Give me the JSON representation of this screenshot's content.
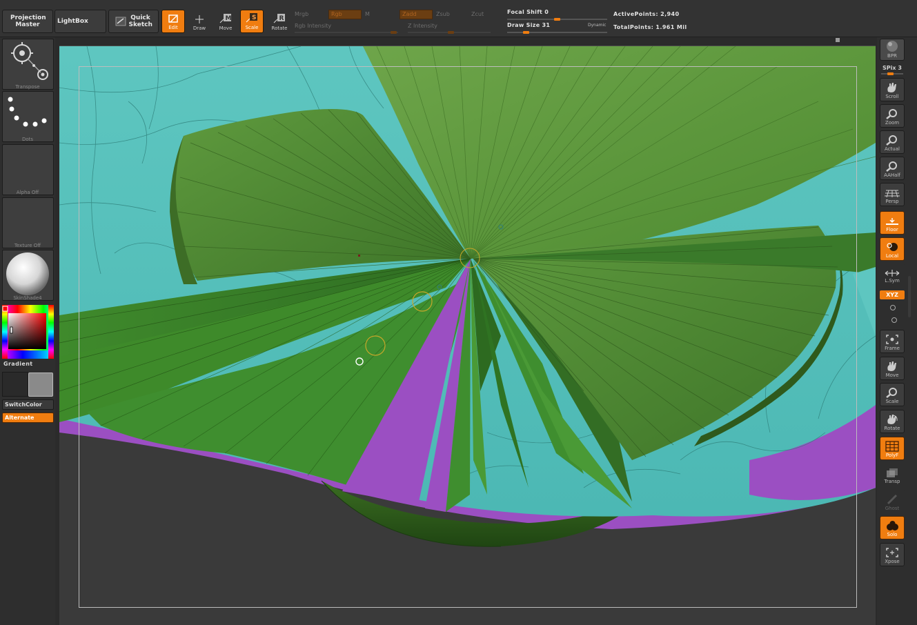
{
  "toolbar": {
    "projection_master": "Projection Master",
    "lightbox": "LightBox",
    "quick_sketch": "Quick Sketch",
    "tools": [
      {
        "label": "Edit",
        "active": true
      },
      {
        "label": "Draw",
        "active": false
      },
      {
        "label": "Move",
        "active": false
      },
      {
        "label": "Scale",
        "active": true
      },
      {
        "label": "Rotate",
        "active": false
      }
    ],
    "mrgb": "Mrgb",
    "rgb": "Rgb",
    "m": "M",
    "zadd": "Zadd",
    "zsub": "Zsub",
    "zcut": "Zcut",
    "rgb_intensity": "Rgb Intensity",
    "z_intensity": "Z Intensity",
    "focal_shift": "Focal Shift 0",
    "focal_shift_value": 0,
    "draw_size": "Draw Size 31",
    "draw_size_value": 31,
    "dynamic": "Dynamic",
    "active_points": "ActivePoints: 2,940",
    "total_points": "TotalPoints: 1.961 Mil"
  },
  "left_shelf": {
    "transpose": "Transpose",
    "dots": "Dots",
    "alpha": "Alpha Off",
    "texture": "Texture Off",
    "material": "SkinShade4",
    "gradient": "Gradient",
    "switch_color": "SwitchColor",
    "alternate": "Alternate",
    "colors": {
      "main": "#ff0000",
      "secondary": "#8a8a8a",
      "accent": "#f07d10"
    }
  },
  "right_shelf": {
    "bpr": "BPR",
    "spix": "SPix 3",
    "buttons": [
      {
        "label": "Scroll",
        "icon": "scroll-hand-icon",
        "active": false
      },
      {
        "label": "Zoom",
        "icon": "zoom-icon",
        "active": false
      },
      {
        "label": "Actual",
        "icon": "actual-zoom-icon",
        "active": false
      },
      {
        "label": "AAHalf",
        "icon": "aahalf-zoom-icon",
        "active": false
      },
      {
        "label": "Persp",
        "icon": "perspective-grid-icon",
        "active": false
      },
      {
        "label": "Floor",
        "icon": "floor-icon",
        "active": true
      },
      {
        "label": "Local",
        "icon": "local-icon",
        "active": true
      },
      {
        "label": "L.Sym",
        "icon": "local-symmetry-icon",
        "active": false
      },
      {
        "label": "Frame",
        "icon": "frame-icon",
        "active": false
      },
      {
        "label": "Move",
        "icon": "move-hand-icon",
        "active": false
      },
      {
        "label": "Scale",
        "icon": "scale-icon",
        "active": false
      },
      {
        "label": "Rotate",
        "icon": "rotate-icon",
        "active": false
      },
      {
        "label": "PolyF",
        "icon": "polyframe-icon",
        "active": true
      },
      {
        "label": "Transp",
        "icon": "transparency-icon",
        "active": false
      },
      {
        "label": "Ghost",
        "icon": "ghost-icon",
        "active": false
      },
      {
        "label": "Solo",
        "icon": "solo-icon",
        "active": true
      },
      {
        "label": "Xpose",
        "icon": "xpose-icon",
        "active": false
      }
    ],
    "xyz": "XYZ"
  }
}
